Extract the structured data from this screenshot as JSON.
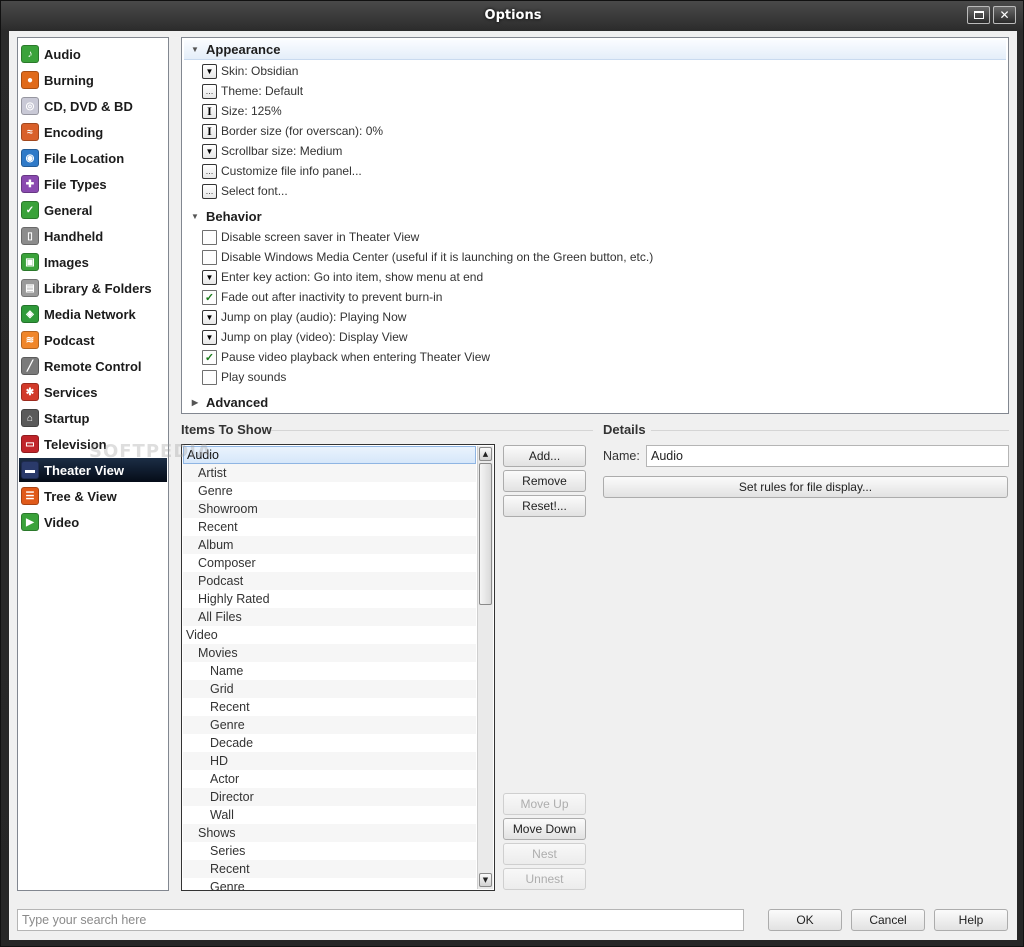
{
  "window": {
    "title": "Options"
  },
  "sidebar": {
    "items": [
      {
        "label": "Audio",
        "icon": "audio-icon",
        "color": "#3aa23a",
        "glyph": "♪",
        "selected": false
      },
      {
        "label": "Burning",
        "icon": "burning-icon",
        "color": "#e06a1a",
        "glyph": "●",
        "selected": false
      },
      {
        "label": "CD, DVD & BD",
        "icon": "disc-icon",
        "color": "#c9c9d6",
        "glyph": "◎",
        "selected": false
      },
      {
        "label": "Encoding",
        "icon": "encoding-icon",
        "color": "#d9602a",
        "glyph": "≈",
        "selected": false
      },
      {
        "label": "File Location",
        "icon": "globe-icon",
        "color": "#2f7ac8",
        "glyph": "◉",
        "selected": false
      },
      {
        "label": "File Types",
        "icon": "puzzle-icon",
        "color": "#8a4ab0",
        "glyph": "✚",
        "selected": false
      },
      {
        "label": "General",
        "icon": "general-icon",
        "color": "#3aa23a",
        "glyph": "✓",
        "selected": false
      },
      {
        "label": "Handheld",
        "icon": "handheld-icon",
        "color": "#8c8c8c",
        "glyph": "▯",
        "selected": false
      },
      {
        "label": "Images",
        "icon": "images-icon",
        "color": "#3aa23a",
        "glyph": "▣",
        "selected": false
      },
      {
        "label": "Library & Folders",
        "icon": "library-icon",
        "color": "#9a9a9a",
        "glyph": "▤",
        "selected": false
      },
      {
        "label": "Media Network",
        "icon": "network-icon",
        "color": "#2f9a3a",
        "glyph": "◈",
        "selected": false
      },
      {
        "label": "Podcast",
        "icon": "rss-icon",
        "color": "#f0862a",
        "glyph": "≋",
        "selected": false
      },
      {
        "label": "Remote Control",
        "icon": "remote-icon",
        "color": "#7a7a7a",
        "glyph": "╱",
        "selected": false
      },
      {
        "label": "Services",
        "icon": "services-icon",
        "color": "#d23a2a",
        "glyph": "✱",
        "selected": false
      },
      {
        "label": "Startup",
        "icon": "startup-icon",
        "color": "#5a5a5a",
        "glyph": "⌂",
        "selected": false
      },
      {
        "label": "Television",
        "icon": "television-icon",
        "color": "#c0242a",
        "glyph": "▭",
        "selected": false
      },
      {
        "label": "Theater View",
        "icon": "theater-icon",
        "color": "#2a3a6a",
        "glyph": "▬",
        "selected": true
      },
      {
        "label": "Tree & View",
        "icon": "tree-icon",
        "color": "#e05a1a",
        "glyph": "☰",
        "selected": false
      },
      {
        "label": "Video",
        "icon": "video-icon",
        "color": "#3aa23a",
        "glyph": "▶",
        "selected": false
      }
    ]
  },
  "options": {
    "appearance": {
      "header": "Appearance",
      "rows": [
        {
          "label": "Skin: Obsidian",
          "control": "dropdown"
        },
        {
          "label": "Theme: Default",
          "control": "ellipsis"
        },
        {
          "label": "Size: 125%",
          "control": "text"
        },
        {
          "label": "Border size (for overscan): 0%",
          "control": "text"
        },
        {
          "label": "Scrollbar size: Medium",
          "control": "dropdown"
        },
        {
          "label": "Customize file info panel...",
          "control": "ellipsis"
        },
        {
          "label": "Select font...",
          "control": "ellipsis"
        }
      ]
    },
    "behavior": {
      "header": "Behavior",
      "rows": [
        {
          "label": "Disable screen saver in Theater View",
          "control": "checkbox",
          "checked": false
        },
        {
          "label": "Disable Windows Media Center (useful if it is launching on the Green button, etc.)",
          "control": "checkbox",
          "checked": false
        },
        {
          "label": "Enter key action: Go into item, show menu at end",
          "control": "dropdown"
        },
        {
          "label": "Fade out after inactivity to prevent burn-in",
          "control": "checkbox",
          "checked": true
        },
        {
          "label": "Jump on play (audio): Playing Now",
          "control": "dropdown"
        },
        {
          "label": "Jump on play (video): Display View",
          "control": "dropdown"
        },
        {
          "label": "Pause video playback when entering Theater View",
          "control": "checkbox",
          "checked": true
        },
        {
          "label": "Play sounds",
          "control": "checkbox",
          "checked": false
        }
      ]
    },
    "advanced": {
      "header": "Advanced"
    }
  },
  "items_to_show": {
    "label": "Items To Show",
    "rows": [
      {
        "label": "Audio",
        "level": 0,
        "selected": true
      },
      {
        "label": "Artist",
        "level": 1
      },
      {
        "label": "Genre",
        "level": 1
      },
      {
        "label": "Showroom",
        "level": 1
      },
      {
        "label": "Recent",
        "level": 1
      },
      {
        "label": "Album",
        "level": 1
      },
      {
        "label": "Composer",
        "level": 1
      },
      {
        "label": "Podcast",
        "level": 1
      },
      {
        "label": "Highly Rated",
        "level": 1
      },
      {
        "label": "All Files",
        "level": 1
      },
      {
        "label": "Video",
        "level": 0
      },
      {
        "label": "Movies",
        "level": 1
      },
      {
        "label": "Name",
        "level": 2
      },
      {
        "label": "Grid",
        "level": 2
      },
      {
        "label": "Recent",
        "level": 2
      },
      {
        "label": "Genre",
        "level": 2
      },
      {
        "label": "Decade",
        "level": 2
      },
      {
        "label": "HD",
        "level": 2
      },
      {
        "label": "Actor",
        "level": 2
      },
      {
        "label": "Director",
        "level": 2
      },
      {
        "label": "Wall",
        "level": 2
      },
      {
        "label": "Shows",
        "level": 1
      },
      {
        "label": "Series",
        "level": 2
      },
      {
        "label": "Recent",
        "level": 2
      },
      {
        "label": "Genre",
        "level": 2
      }
    ],
    "buttons": {
      "add": "Add...",
      "remove": "Remove",
      "reset": "Reset!...",
      "move_up": "Move Up",
      "move_down": "Move Down",
      "nest": "Nest",
      "unnest": "Unnest"
    }
  },
  "details": {
    "label": "Details",
    "name_label": "Name:",
    "name_value": "Audio",
    "rules_button": "Set rules for file display..."
  },
  "footer": {
    "search_placeholder": "Type your search here",
    "ok": "OK",
    "cancel": "Cancel",
    "help": "Help"
  },
  "watermark": "SOFTPEDIA"
}
